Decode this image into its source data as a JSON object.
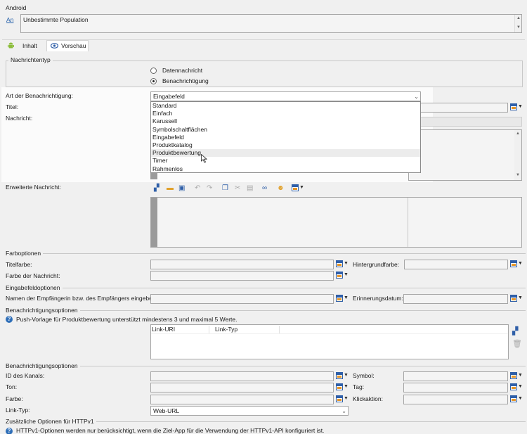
{
  "android": {
    "section": "Android",
    "to_link": "An",
    "population": "Unbestimmte Population"
  },
  "tabs": [
    {
      "label": "Inhalt"
    },
    {
      "label": "Vorschau"
    }
  ],
  "nachrichtentyp": {
    "section": "Nachrichtentyp",
    "options": [
      "Datennachricht",
      "Benachrichtigung"
    ],
    "selected": "Benachrichtigung"
  },
  "art": {
    "label": "Art der Benachrichtigung:",
    "value": "Eingabefeld",
    "options": [
      "Standard",
      "Einfach",
      "Karussell",
      "Symbolschaltflächen",
      "Eingabefeld",
      "Produktkatalog",
      "Produktbewertung",
      "Timer",
      "Rahmenlos"
    ],
    "hovered": "Produktbewertung"
  },
  "titel_label": "Titel:",
  "nachricht_label": "Nachricht:",
  "erweiterte_label": "Erweiterte Nachricht:",
  "farboptionen": {
    "section": "Farboptionen",
    "titelfarbe": "Titelfarbe:",
    "hintergrundfarbe": "Hintergrundfarbe:",
    "farbe_nachricht": "Farbe der Nachricht:"
  },
  "eingabefeld": {
    "section": "Eingabefeldoptionen",
    "empfaenger": "Namen der Empfängerin bzw. des Empfängers eingeben:",
    "erinnerung": "Erinnerungsdatum:"
  },
  "benachrichtigung1": {
    "section": "Benachrichtigungsoptionen",
    "info": "Push-Vorlage für Produktbewertung unterstützt mindestens 3 und maximal 5 Werte.",
    "col_uri": "Link-URI",
    "col_typ": "Link-Typ"
  },
  "benachrichtigung2": {
    "section": "Benachrichtigungsoptionen",
    "kanal": "ID des Kanals:",
    "symbol": "Symbol:",
    "ton": "Ton:",
    "tag": "Tag:",
    "farbe": "Farbe:",
    "klick": "Klickaktion:",
    "linktyp": "Link-Typ:",
    "linktyp_value": "Web-URL"
  },
  "httpv1": {
    "section": "Zusätzliche Optionen für HTTPv1",
    "info": "HTTPv1-Optionen werden nur berücksichtigt, wenn die Ziel-App für die Verwendung der HTTPv1-API konfiguriert ist."
  }
}
